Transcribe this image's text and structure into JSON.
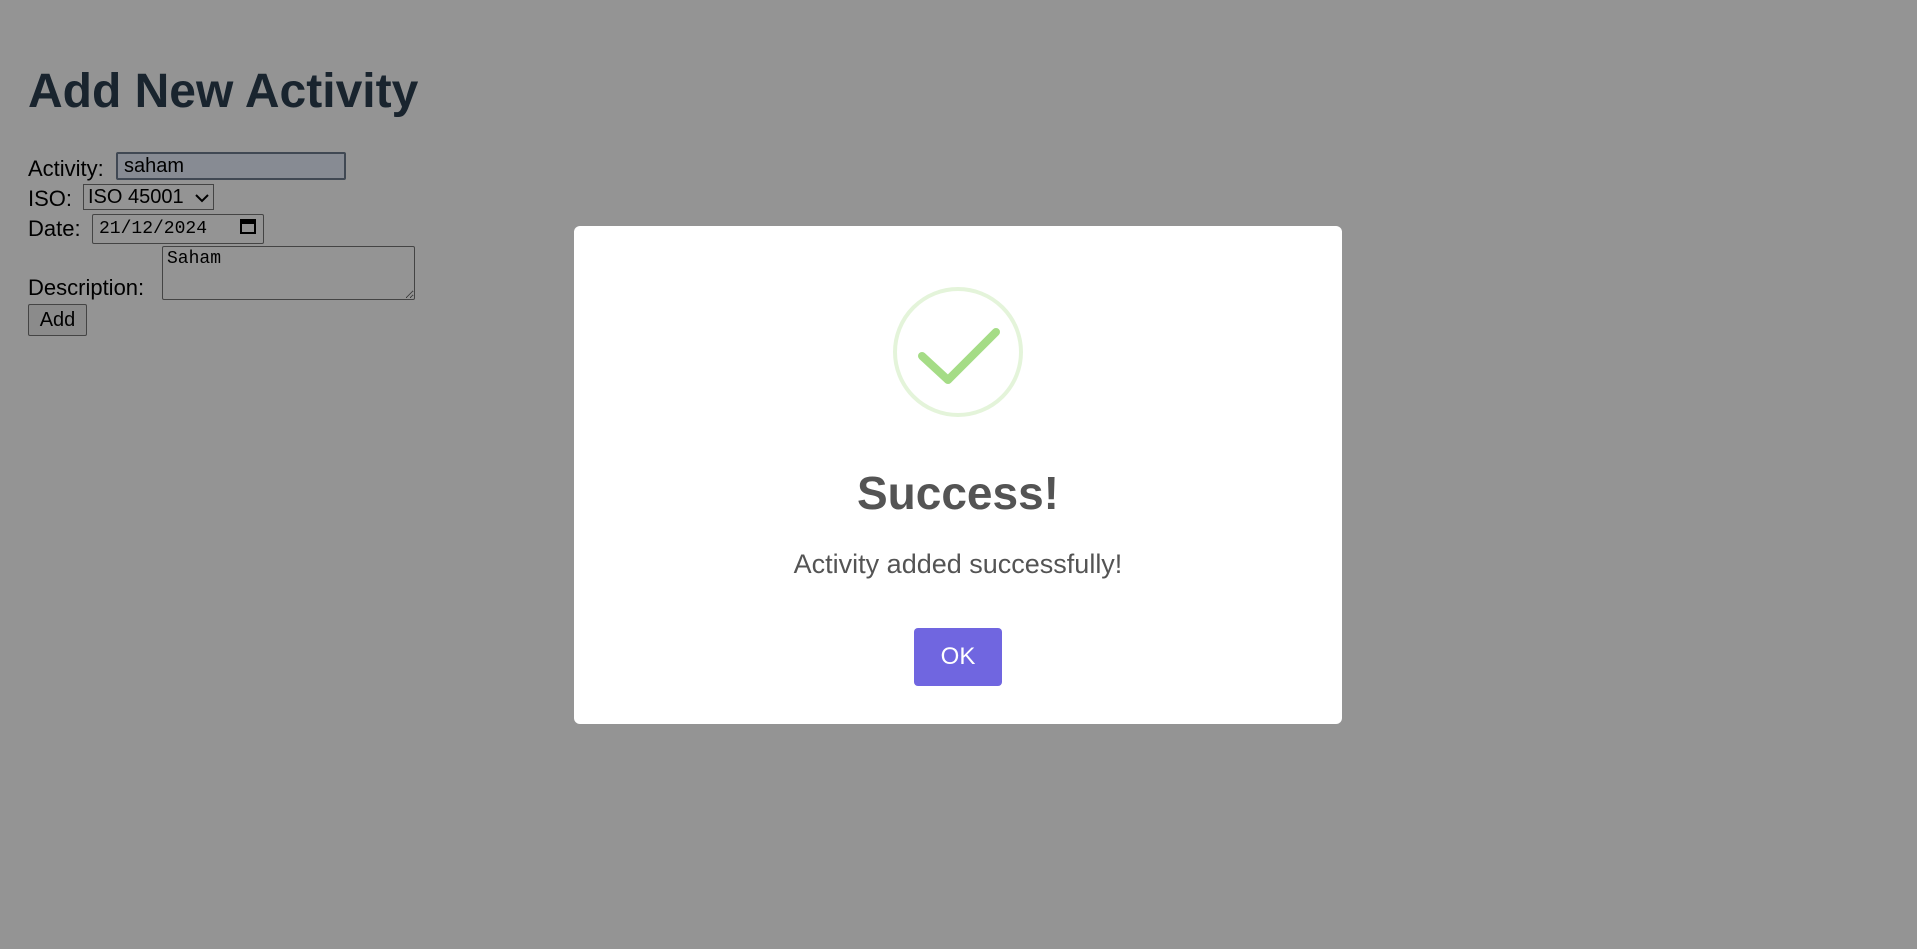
{
  "page": {
    "title": "Add New Activity"
  },
  "form": {
    "activity_label": "Activity:",
    "activity_value": "saham",
    "iso_label": "ISO:",
    "iso_selected": "ISO 45001",
    "date_label": "Date:",
    "date_value": "21/12/2024",
    "description_label": "Description:",
    "description_value": "Saham",
    "add_label": "Add"
  },
  "modal": {
    "icon": "success-check-icon",
    "title": "Success!",
    "text": "Activity added successfully!",
    "ok_label": "OK"
  },
  "colors": {
    "page_title": "#2c3e50",
    "overlay": "rgba(0,0,0,0.42)",
    "ok_button": "#7066e0",
    "success_check": "#a5dc86",
    "success_ring": "rgba(165,220,134,0.3)"
  }
}
